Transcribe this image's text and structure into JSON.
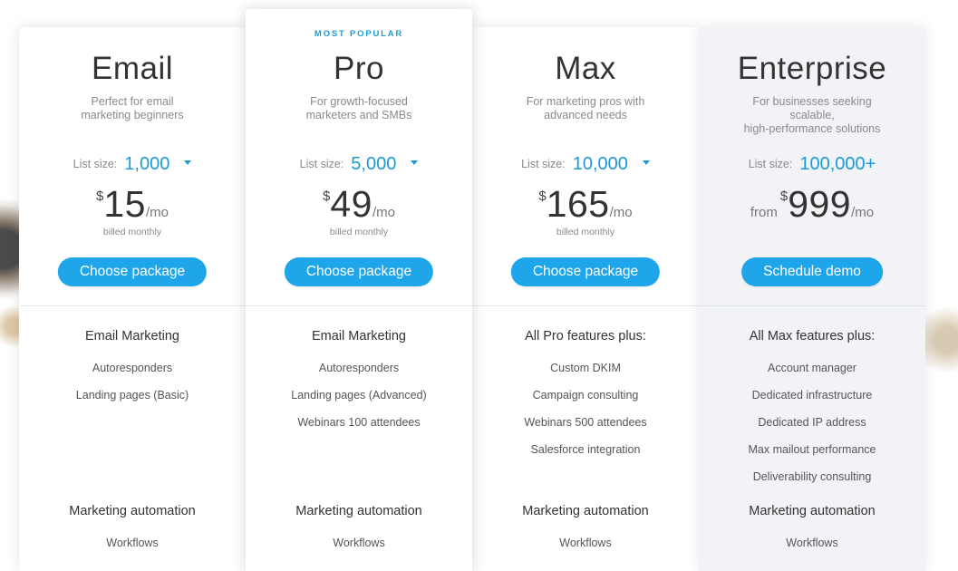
{
  "plans": [
    {
      "name": "Email",
      "badge": "",
      "desc_line1": "Perfect for email",
      "desc_line2": "marketing beginners",
      "list_size_label": "List size:",
      "list_size_value": "1,000",
      "from_label": "",
      "currency": "$",
      "price": "15",
      "per": "/mo",
      "billed": "billed monthly",
      "button": "Choose package",
      "section1_title": "Email Marketing",
      "section1_features": [
        "Autoresponders",
        "Landing pages (Basic)"
      ],
      "section2_title": "Marketing automation",
      "section2_features": [
        "Workflows"
      ]
    },
    {
      "name": "Pro",
      "badge": "MOST POPULAR",
      "desc_line1": "For growth-focused",
      "desc_line2": "marketers and SMBs",
      "list_size_label": "List size:",
      "list_size_value": "5,000",
      "from_label": "",
      "currency": "$",
      "price": "49",
      "per": "/mo",
      "billed": "billed monthly",
      "button": "Choose package",
      "section1_title": "Email Marketing",
      "section1_features": [
        "Autoresponders",
        "Landing pages (Advanced)",
        "Webinars 100 attendees"
      ],
      "section2_title": "Marketing automation",
      "section2_features": [
        "Workflows"
      ]
    },
    {
      "name": "Max",
      "badge": "",
      "desc_line1": "For marketing pros with",
      "desc_line2": "advanced needs",
      "list_size_label": "List size:",
      "list_size_value": "10,000",
      "from_label": "",
      "currency": "$",
      "price": "165",
      "per": "/mo",
      "billed": "billed monthly",
      "button": "Choose package",
      "section1_title": "All Pro features plus:",
      "section1_features": [
        "Custom DKIM",
        "Campaign consulting",
        "Webinars 500 attendees",
        "Salesforce integration"
      ],
      "section2_title": "Marketing automation",
      "section2_features": [
        "Workflows"
      ]
    },
    {
      "name": "Enterprise",
      "badge": "",
      "desc_line1": "For businesses seeking scalable,",
      "desc_line2": "high-performance solutions",
      "list_size_label": "List size:",
      "list_size_value": "100,000+",
      "from_label": "from",
      "currency": "$",
      "price": "999",
      "per": "/mo",
      "billed": "",
      "button": "Schedule demo",
      "section1_title": "All Max features plus:",
      "section1_features": [
        "Account manager",
        "Dedicated infrastructure",
        "Dedicated IP address",
        "Max mailout performance",
        "Deliverability consulting"
      ],
      "section2_title": "Marketing automation",
      "section2_features": [
        "Workflows"
      ]
    }
  ],
  "colors": {
    "accent": "#1a9bd7",
    "button": "#1fa6ea",
    "enterprise_bg": "#f2f3f7"
  },
  "icons": {
    "dropdown": "caret-down-icon"
  }
}
